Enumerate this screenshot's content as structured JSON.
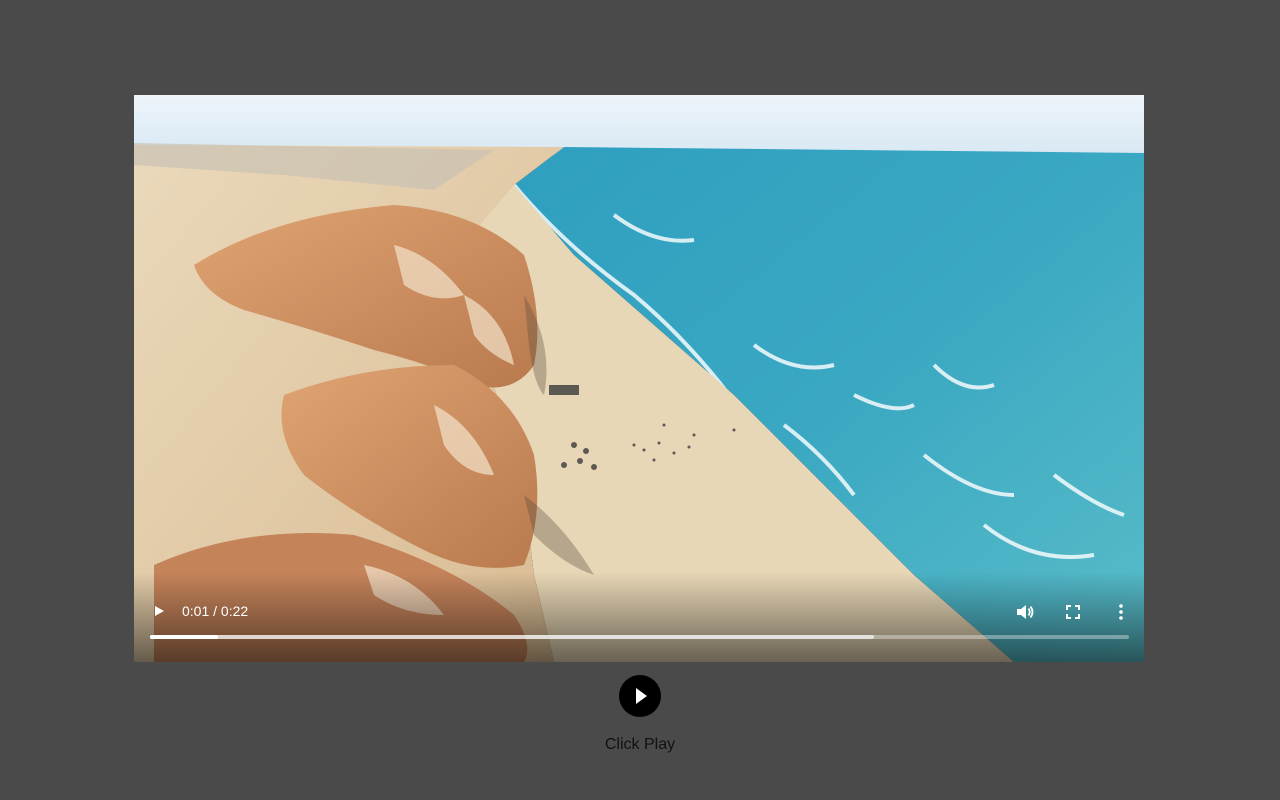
{
  "player": {
    "current_time": "0:01",
    "separator": " / ",
    "duration": "0:22",
    "played_fraction": 0.069,
    "buffered_fraction": 0.74
  },
  "icons": {
    "play": "play-icon",
    "volume": "volume-icon",
    "fullscreen": "fullscreen-icon",
    "more": "more-options-icon",
    "big_play": "play-circle-icon"
  },
  "caption": {
    "label": "Click Play"
  },
  "colors": {
    "page_background": "#4a4a4a",
    "sea": "#3aa3bd",
    "sand": "#e6cfa8",
    "cliff": "#d98f5c",
    "sky": "#dfeef8"
  }
}
